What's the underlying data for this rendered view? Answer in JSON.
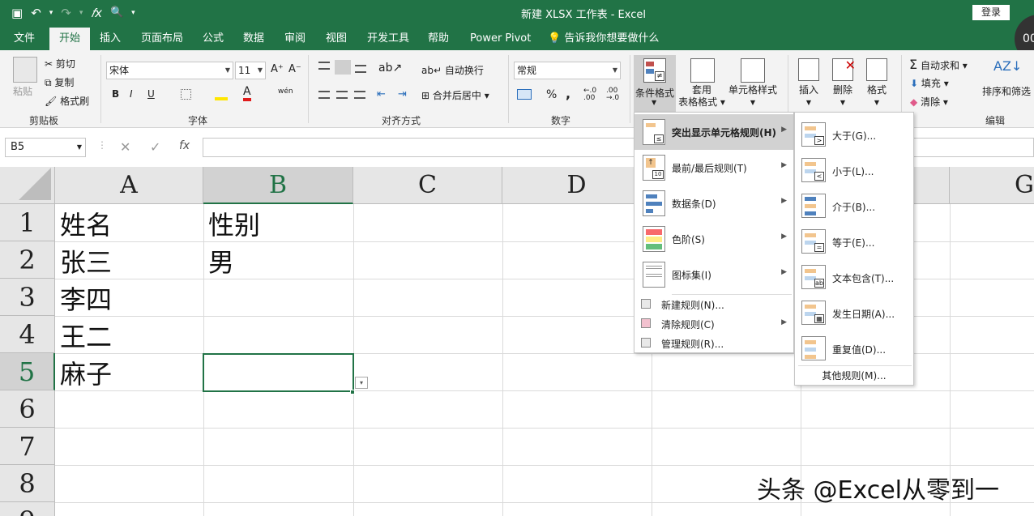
{
  "titlebar": {
    "title": "新建 XLSX 工作表  -  Excel",
    "login": "登录",
    "qat": {
      "save_icon": "▣",
      "undo_icon": "↶",
      "undo_arrow": "▾",
      "redo_icon": "↷",
      "redo_arrow": "▾",
      "fx_icon": "𝑓x",
      "preview_icon": "🔍",
      "customize_icon": "▾"
    }
  },
  "tabs": [
    "文件",
    "开始",
    "插入",
    "页面布局",
    "公式",
    "数据",
    "审阅",
    "视图",
    "开发工具",
    "帮助",
    "Power Pivot"
  ],
  "active_tab": "开始",
  "tellme": "告诉我你想要做什么",
  "avatar_text": "00",
  "ribbon": {
    "clipboard": {
      "paste": "粘贴",
      "cut": "剪切",
      "copy": "复制",
      "format_painter": "格式刷",
      "label": "剪贴板"
    },
    "font": {
      "font_name": "宋体",
      "font_size": "11",
      "bold": "B",
      "italic": "I",
      "underline": "U",
      "grow": "A⁺",
      "shrink": "A⁻",
      "font_color": "A",
      "phonetic": "wén",
      "label": "字体"
    },
    "alignment": {
      "wrap": "自动换行",
      "merge": "合并后居中",
      "label": "对齐方式"
    },
    "number": {
      "format": "常规",
      "percent": "%",
      "comma": ",",
      "inc_dec": "←.0 .00",
      "dec_dec": ".00 →.0",
      "label": "数字"
    },
    "styles": {
      "conditional": "条件格式",
      "table_format_1": "套用",
      "table_format_2": "表格格式",
      "cell_styles": "单元格样式"
    },
    "cells": {
      "insert": "插入",
      "delete": "删除",
      "format": "格式"
    },
    "editing": {
      "autosum": "自动求和",
      "fill": "填充",
      "clear": "清除",
      "sort_filter": "排序和筛选",
      "label": "编辑"
    }
  },
  "formula_bar": {
    "name_box": "B5",
    "cancel": "✕",
    "enter": "✓",
    "fx": "fx",
    "value": ""
  },
  "grid": {
    "columns": [
      "A",
      "B",
      "C",
      "D",
      "G"
    ],
    "rows": [
      "1",
      "2",
      "3",
      "4",
      "5",
      "6",
      "7",
      "8",
      "9"
    ],
    "cells": {
      "A1": "姓名",
      "B1": "性别",
      "A2": "张三",
      "B2": "男",
      "A3": "李四",
      "A4": "王二",
      "A5": "麻子"
    },
    "active_cell": "B5",
    "paste_options_icon": "▾"
  },
  "menu_conditional": {
    "items": [
      {
        "label": "突出显示单元格规则(H)",
        "has_sub": true,
        "highlighted": true
      },
      {
        "label": "最前/最后规则(T)",
        "has_sub": true
      },
      {
        "label": "数据条(D)",
        "has_sub": true
      },
      {
        "label": "色阶(S)",
        "has_sub": true
      },
      {
        "label": "图标集(I)",
        "has_sub": true
      }
    ],
    "small_items": [
      {
        "label": "新建规则(N)...",
        "has_sub": false
      },
      {
        "label": "清除规则(C)",
        "has_sub": true
      },
      {
        "label": "管理规则(R)..."
      }
    ],
    "arrow": "▶"
  },
  "menu_highlight_rules": {
    "items": [
      {
        "label": "大于(G)...",
        "sym": ">"
      },
      {
        "label": "小于(L)...",
        "sym": "<"
      },
      {
        "label": "介于(B)...",
        "sym": "↔"
      },
      {
        "label": "等于(E)...",
        "sym": "="
      },
      {
        "label": "文本包含(T)...",
        "sym": "ab"
      },
      {
        "label": "发生日期(A)...",
        "sym": "▦"
      },
      {
        "label": "重复值(D)...",
        "sym": ""
      }
    ],
    "more": "其他规则(M)..."
  },
  "watermark": "头条 @Excel从零到一",
  "colors": {
    "accent": "#217346",
    "ribbon_bg": "#f3f3f3",
    "header_bg": "#e6e6e6"
  }
}
